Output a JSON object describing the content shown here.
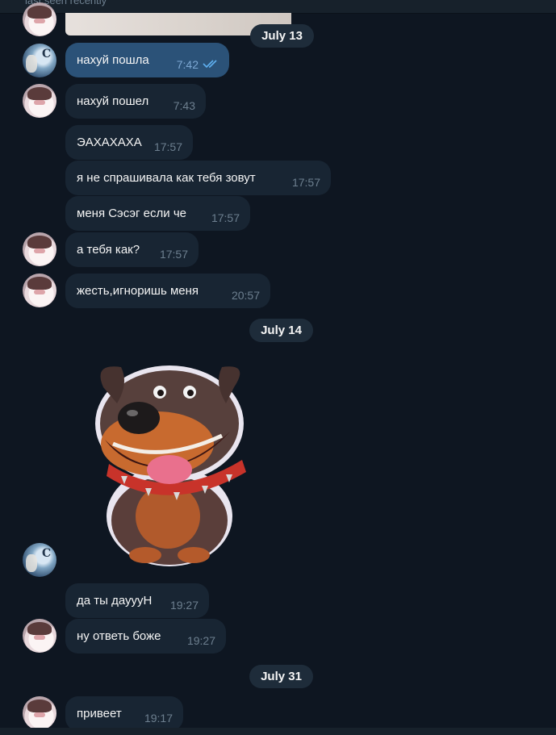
{
  "header": {
    "status": "last seen recently"
  },
  "dates": [
    "July 13",
    "July 14",
    "July 31"
  ],
  "messages": [
    {
      "text": "нахуй пошла",
      "time": "7:42",
      "outgoing": true,
      "read": true
    },
    {
      "text": "нахуй пошел",
      "time": "7:43"
    },
    {
      "text": "ЭАХАХАХА",
      "time": "17:57"
    },
    {
      "text": "я не спрашивала как тебя зовут",
      "time": "17:57"
    },
    {
      "text": "меня Сэсэг если че",
      "time": "17:57"
    },
    {
      "text": "а тебя как?",
      "time": "17:57"
    },
    {
      "text": "жесть,игноришь меня",
      "time": "20:57"
    },
    {
      "text": "да ты дауууН",
      "time": "19:27"
    },
    {
      "text": "ну ответь боже",
      "time": "19:27"
    },
    {
      "text": "привеет",
      "time": "19:17"
    }
  ],
  "sticker": {
    "icon": "dog-sticker-icon"
  },
  "colors": {
    "background": "#0e1621",
    "incoming_bubble": "#182533",
    "outgoing_bubble": "#2b5278",
    "read_ticks": "#5fb1f2"
  }
}
